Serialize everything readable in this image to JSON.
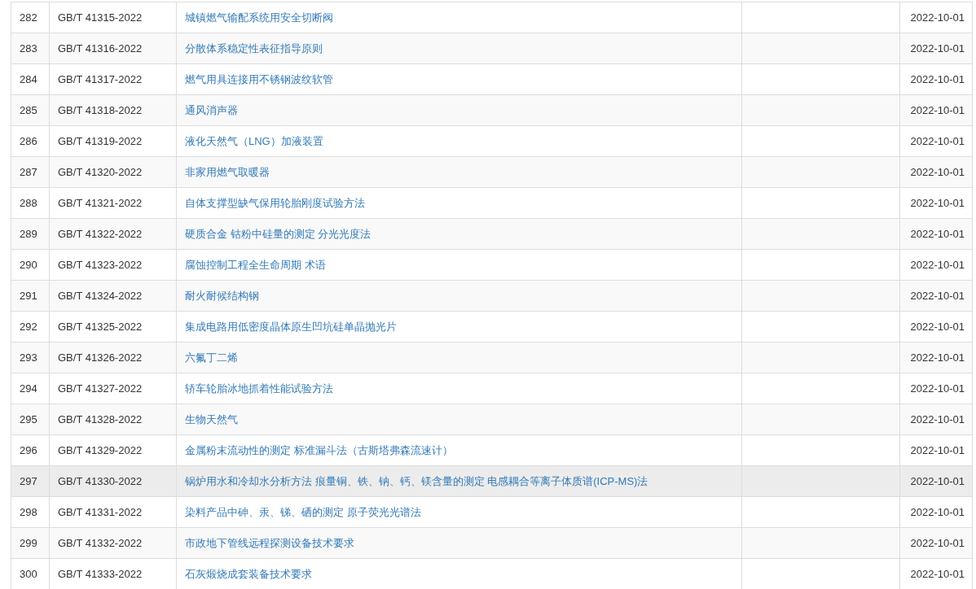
{
  "table": {
    "rows": [
      {
        "number": "282",
        "code": "GB/T 41315-2022",
        "title": "城镇燃气输配系统用安全切断阀",
        "date": "2022-10-01",
        "highlighted": false
      },
      {
        "number": "283",
        "code": "GB/T 41316-2022",
        "title": "分散体系稳定性表征指导原则",
        "date": "2022-10-01",
        "highlighted": false
      },
      {
        "number": "284",
        "code": "GB/T 41317-2022",
        "title": "燃气用具连接用不锈钢波纹软管",
        "date": "2022-10-01",
        "highlighted": false
      },
      {
        "number": "285",
        "code": "GB/T 41318-2022",
        "title": "通风消声器",
        "date": "2022-10-01",
        "highlighted": false
      },
      {
        "number": "286",
        "code": "GB/T 41319-2022",
        "title": "液化天然气（LNG）加液装置",
        "date": "2022-10-01",
        "highlighted": false
      },
      {
        "number": "287",
        "code": "GB/T 41320-2022",
        "title": "非家用燃气取暖器",
        "date": "2022-10-01",
        "highlighted": false
      },
      {
        "number": "288",
        "code": "GB/T 41321-2022",
        "title": "自体支撑型缺气保用轮胎刚度试验方法",
        "date": "2022-10-01",
        "highlighted": false
      },
      {
        "number": "289",
        "code": "GB/T 41322-2022",
        "title": "硬质合金 钴粉中硅量的测定 分光光度法",
        "date": "2022-10-01",
        "highlighted": false
      },
      {
        "number": "290",
        "code": "GB/T 41323-2022",
        "title": "腐蚀控制工程全生命周期 术语",
        "date": "2022-10-01",
        "highlighted": false
      },
      {
        "number": "291",
        "code": "GB/T 41324-2022",
        "title": "耐火耐候结构钢",
        "date": "2022-10-01",
        "highlighted": false
      },
      {
        "number": "292",
        "code": "GB/T 41325-2022",
        "title": "集成电路用低密度晶体原生凹坑硅单晶抛光片",
        "date": "2022-10-01",
        "highlighted": false
      },
      {
        "number": "293",
        "code": "GB/T 41326-2022",
        "title": "六氟丁二烯",
        "date": "2022-10-01",
        "highlighted": false
      },
      {
        "number": "294",
        "code": "GB/T 41327-2022",
        "title": "轿车轮胎冰地抓着性能试验方法",
        "date": "2022-10-01",
        "highlighted": false
      },
      {
        "number": "295",
        "code": "GB/T 41328-2022",
        "title": "生物天然气",
        "date": "2022-10-01",
        "highlighted": false
      },
      {
        "number": "296",
        "code": "GB/T 41329-2022",
        "title": "金属粉末流动性的测定 标准漏斗法（古斯塔弗森流速计）",
        "date": "2022-10-01",
        "highlighted": false
      },
      {
        "number": "297",
        "code": "GB/T 41330-2022",
        "title": "锅炉用水和冷却水分析方法 痕量铜、铁、钠、钙、镁含量的测定 电感耦合等离子体质谱(ICP-MS)法",
        "date": "2022-10-01",
        "highlighted": true
      },
      {
        "number": "298",
        "code": "GB/T 41331-2022",
        "title": "染料产品中砷、汞、锑、硒的测定 原子荧光光谱法",
        "date": "2022-10-01",
        "highlighted": false
      },
      {
        "number": "299",
        "code": "GB/T 41332-2022",
        "title": "市政地下管线远程探测设备技术要求",
        "date": "2022-10-01",
        "highlighted": false
      },
      {
        "number": "300",
        "code": "GB/T 41333-2022",
        "title": "石灰煅烧成套装备技术要求",
        "date": "2022-10-01",
        "highlighted": false
      }
    ]
  }
}
